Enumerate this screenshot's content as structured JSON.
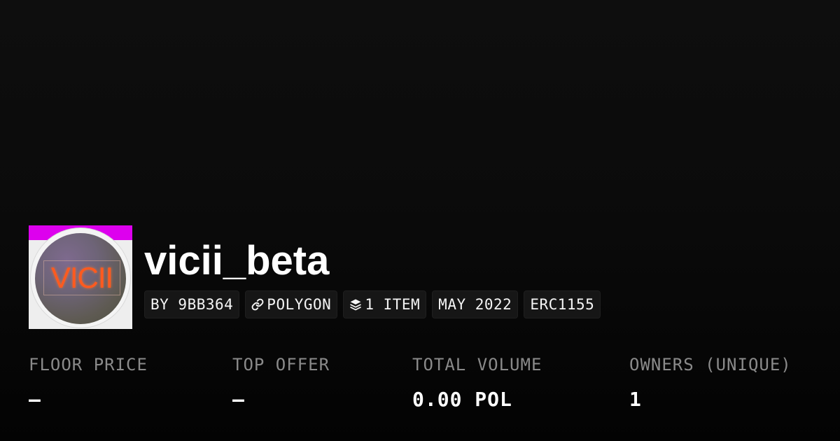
{
  "collection": {
    "name": "vicii_beta",
    "avatar_text": "VICII",
    "avatar_accent_color": "#dd00ee"
  },
  "tags": [
    {
      "label": "BY 9BB364",
      "icon": null
    },
    {
      "label": "POLYGON",
      "icon": "chain-link-icon"
    },
    {
      "label": "1 ITEM",
      "icon": "layers-icon"
    },
    {
      "label": "MAY 2022",
      "icon": null
    },
    {
      "label": "ERC1155",
      "icon": null
    }
  ],
  "stats": [
    {
      "label": "FLOOR PRICE",
      "value": "–"
    },
    {
      "label": "TOP OFFER",
      "value": "–"
    },
    {
      "label": "TOTAL VOLUME",
      "value": "0.00 POL"
    },
    {
      "label": "OWNERS (UNIQUE)",
      "value": "1"
    }
  ]
}
